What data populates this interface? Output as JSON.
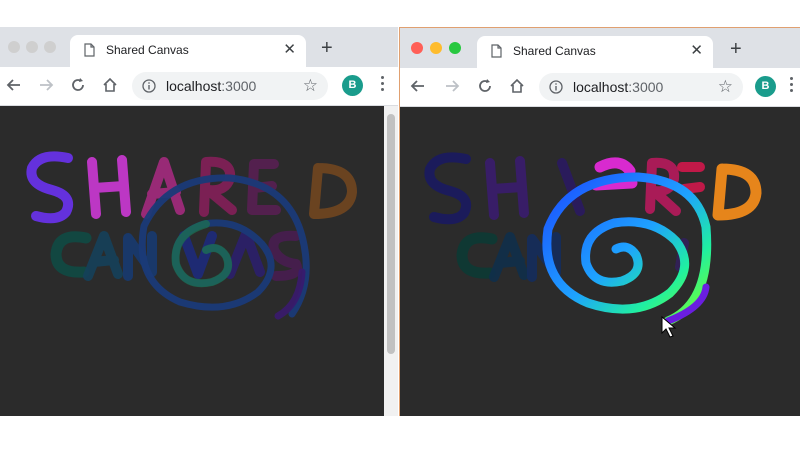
{
  "windows": [
    {
      "tab_title": "Shared Canvas",
      "url_host": "localhost",
      "url_port": ":3000",
      "avatar_letter": "B",
      "icons": [
        "page-icon",
        "close-icon",
        "plus-icon",
        "back-icon",
        "forward-icon",
        "reload-icon",
        "home-icon",
        "info-icon",
        "star-icon",
        "kebab-icon"
      ],
      "focused": false
    },
    {
      "tab_title": "Shared Canvas",
      "url_host": "localhost",
      "url_port": ":3000",
      "avatar_letter": "B",
      "icons": [
        "page-icon",
        "close-icon",
        "plus-icon",
        "back-icon",
        "forward-icon",
        "reload-icon",
        "home-icon",
        "info-icon",
        "star-icon",
        "kebab-icon"
      ],
      "focused": true
    }
  ],
  "colors": {
    "canvas_bg": "#2b2b2b",
    "traffic_close": "#ff5f57",
    "traffic_min": "#febc2e",
    "traffic_max": "#28c840",
    "traffic_inactive": "#cfcfcf"
  }
}
